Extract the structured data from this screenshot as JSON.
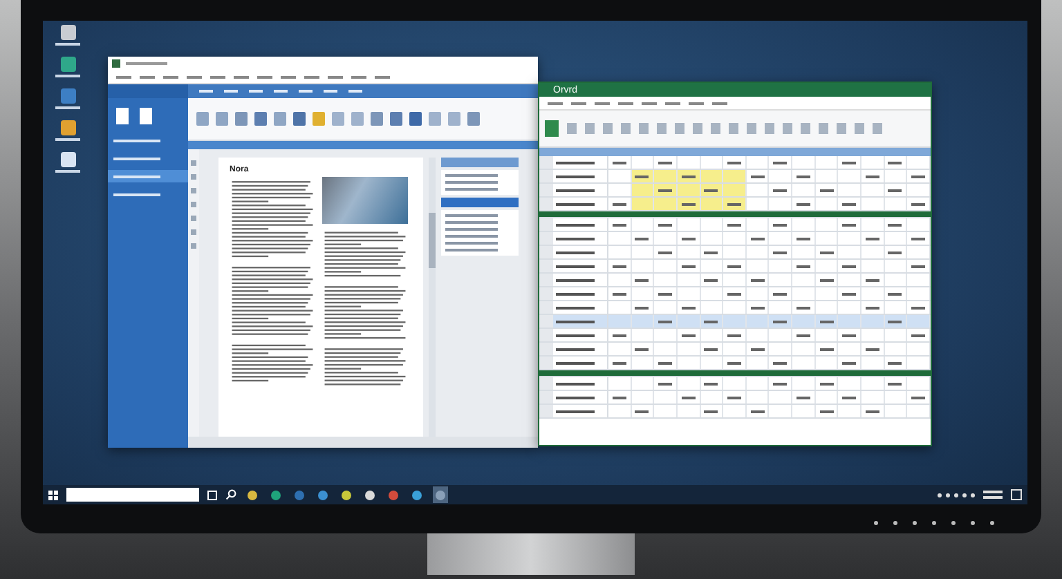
{
  "desktop_icons": [
    {
      "color": "#c8ccd2"
    },
    {
      "color": "#2fa88a"
    },
    {
      "color": "#3d7fc4"
    },
    {
      "color": "#e0a030"
    },
    {
      "color": "#d9e4f2"
    }
  ],
  "word": {
    "document": {
      "heading": "Nora"
    },
    "backstage_items": [
      {
        "selected": false
      },
      {
        "selected": false
      },
      {
        "selected": true
      },
      {
        "selected": false
      }
    ],
    "ribbon_icons": [
      {
        "color": "#8fa6c4"
      },
      {
        "color": "#8fa6c4"
      },
      {
        "color": "#7d96b8"
      },
      {
        "color": "#5d7fb0"
      },
      {
        "color": "#8fa6c4"
      },
      {
        "color": "#4f74a8"
      },
      {
        "color": "#e0b030"
      },
      {
        "color": "#9fb2cc"
      },
      {
        "color": "#9fb2cc"
      },
      {
        "color": "#7d96b8"
      },
      {
        "color": "#5d7fb0"
      },
      {
        "color": "#3f6aa8"
      },
      {
        "color": "#9fb2cc"
      },
      {
        "color": "#9fb2cc"
      },
      {
        "color": "#7d96b8"
      }
    ],
    "pane_sections": [
      {
        "selected": false
      },
      {
        "selected": true
      }
    ]
  },
  "excel": {
    "title": "Orvrd",
    "rows": [
      {
        "kind": "data",
        "highlight": false,
        "selected": false
      },
      {
        "kind": "data",
        "highlight": true,
        "selected": false
      },
      {
        "kind": "data",
        "highlight": true,
        "selected": false
      },
      {
        "kind": "data",
        "highlight": true,
        "selected": false
      },
      {
        "kind": "band",
        "selected": false
      },
      {
        "kind": "data",
        "highlight": false,
        "selected": false
      },
      {
        "kind": "data",
        "highlight": false,
        "selected": false
      },
      {
        "kind": "data",
        "highlight": false,
        "selected": false
      },
      {
        "kind": "data",
        "highlight": false,
        "selected": false
      },
      {
        "kind": "data",
        "highlight": false,
        "selected": false
      },
      {
        "kind": "data",
        "highlight": false,
        "selected": false
      },
      {
        "kind": "data",
        "highlight": false,
        "selected": false
      },
      {
        "kind": "data",
        "highlight": false,
        "selected": true
      },
      {
        "kind": "data",
        "highlight": false,
        "selected": false
      },
      {
        "kind": "data",
        "highlight": false,
        "selected": false
      },
      {
        "kind": "data",
        "highlight": false,
        "selected": false
      },
      {
        "kind": "band",
        "selected": false
      },
      {
        "kind": "data",
        "highlight": false,
        "selected": false
      },
      {
        "kind": "data",
        "highlight": false,
        "selected": false
      },
      {
        "kind": "data",
        "highlight": false,
        "selected": false
      }
    ]
  },
  "taskbar": {
    "apps": [
      {
        "color": "#d8b840",
        "selected": false
      },
      {
        "color": "#1fa37b",
        "selected": false
      },
      {
        "color": "#2e6fb0",
        "selected": false
      },
      {
        "color": "#3b8fd0",
        "selected": false
      },
      {
        "color": "#c8c83a",
        "selected": false
      },
      {
        "color": "#d9d9d9",
        "selected": false
      },
      {
        "color": "#d24b3c",
        "selected": false
      },
      {
        "color": "#3aa0d8",
        "selected": false
      },
      {
        "color": "#8aa0b8",
        "selected": true
      }
    ]
  }
}
